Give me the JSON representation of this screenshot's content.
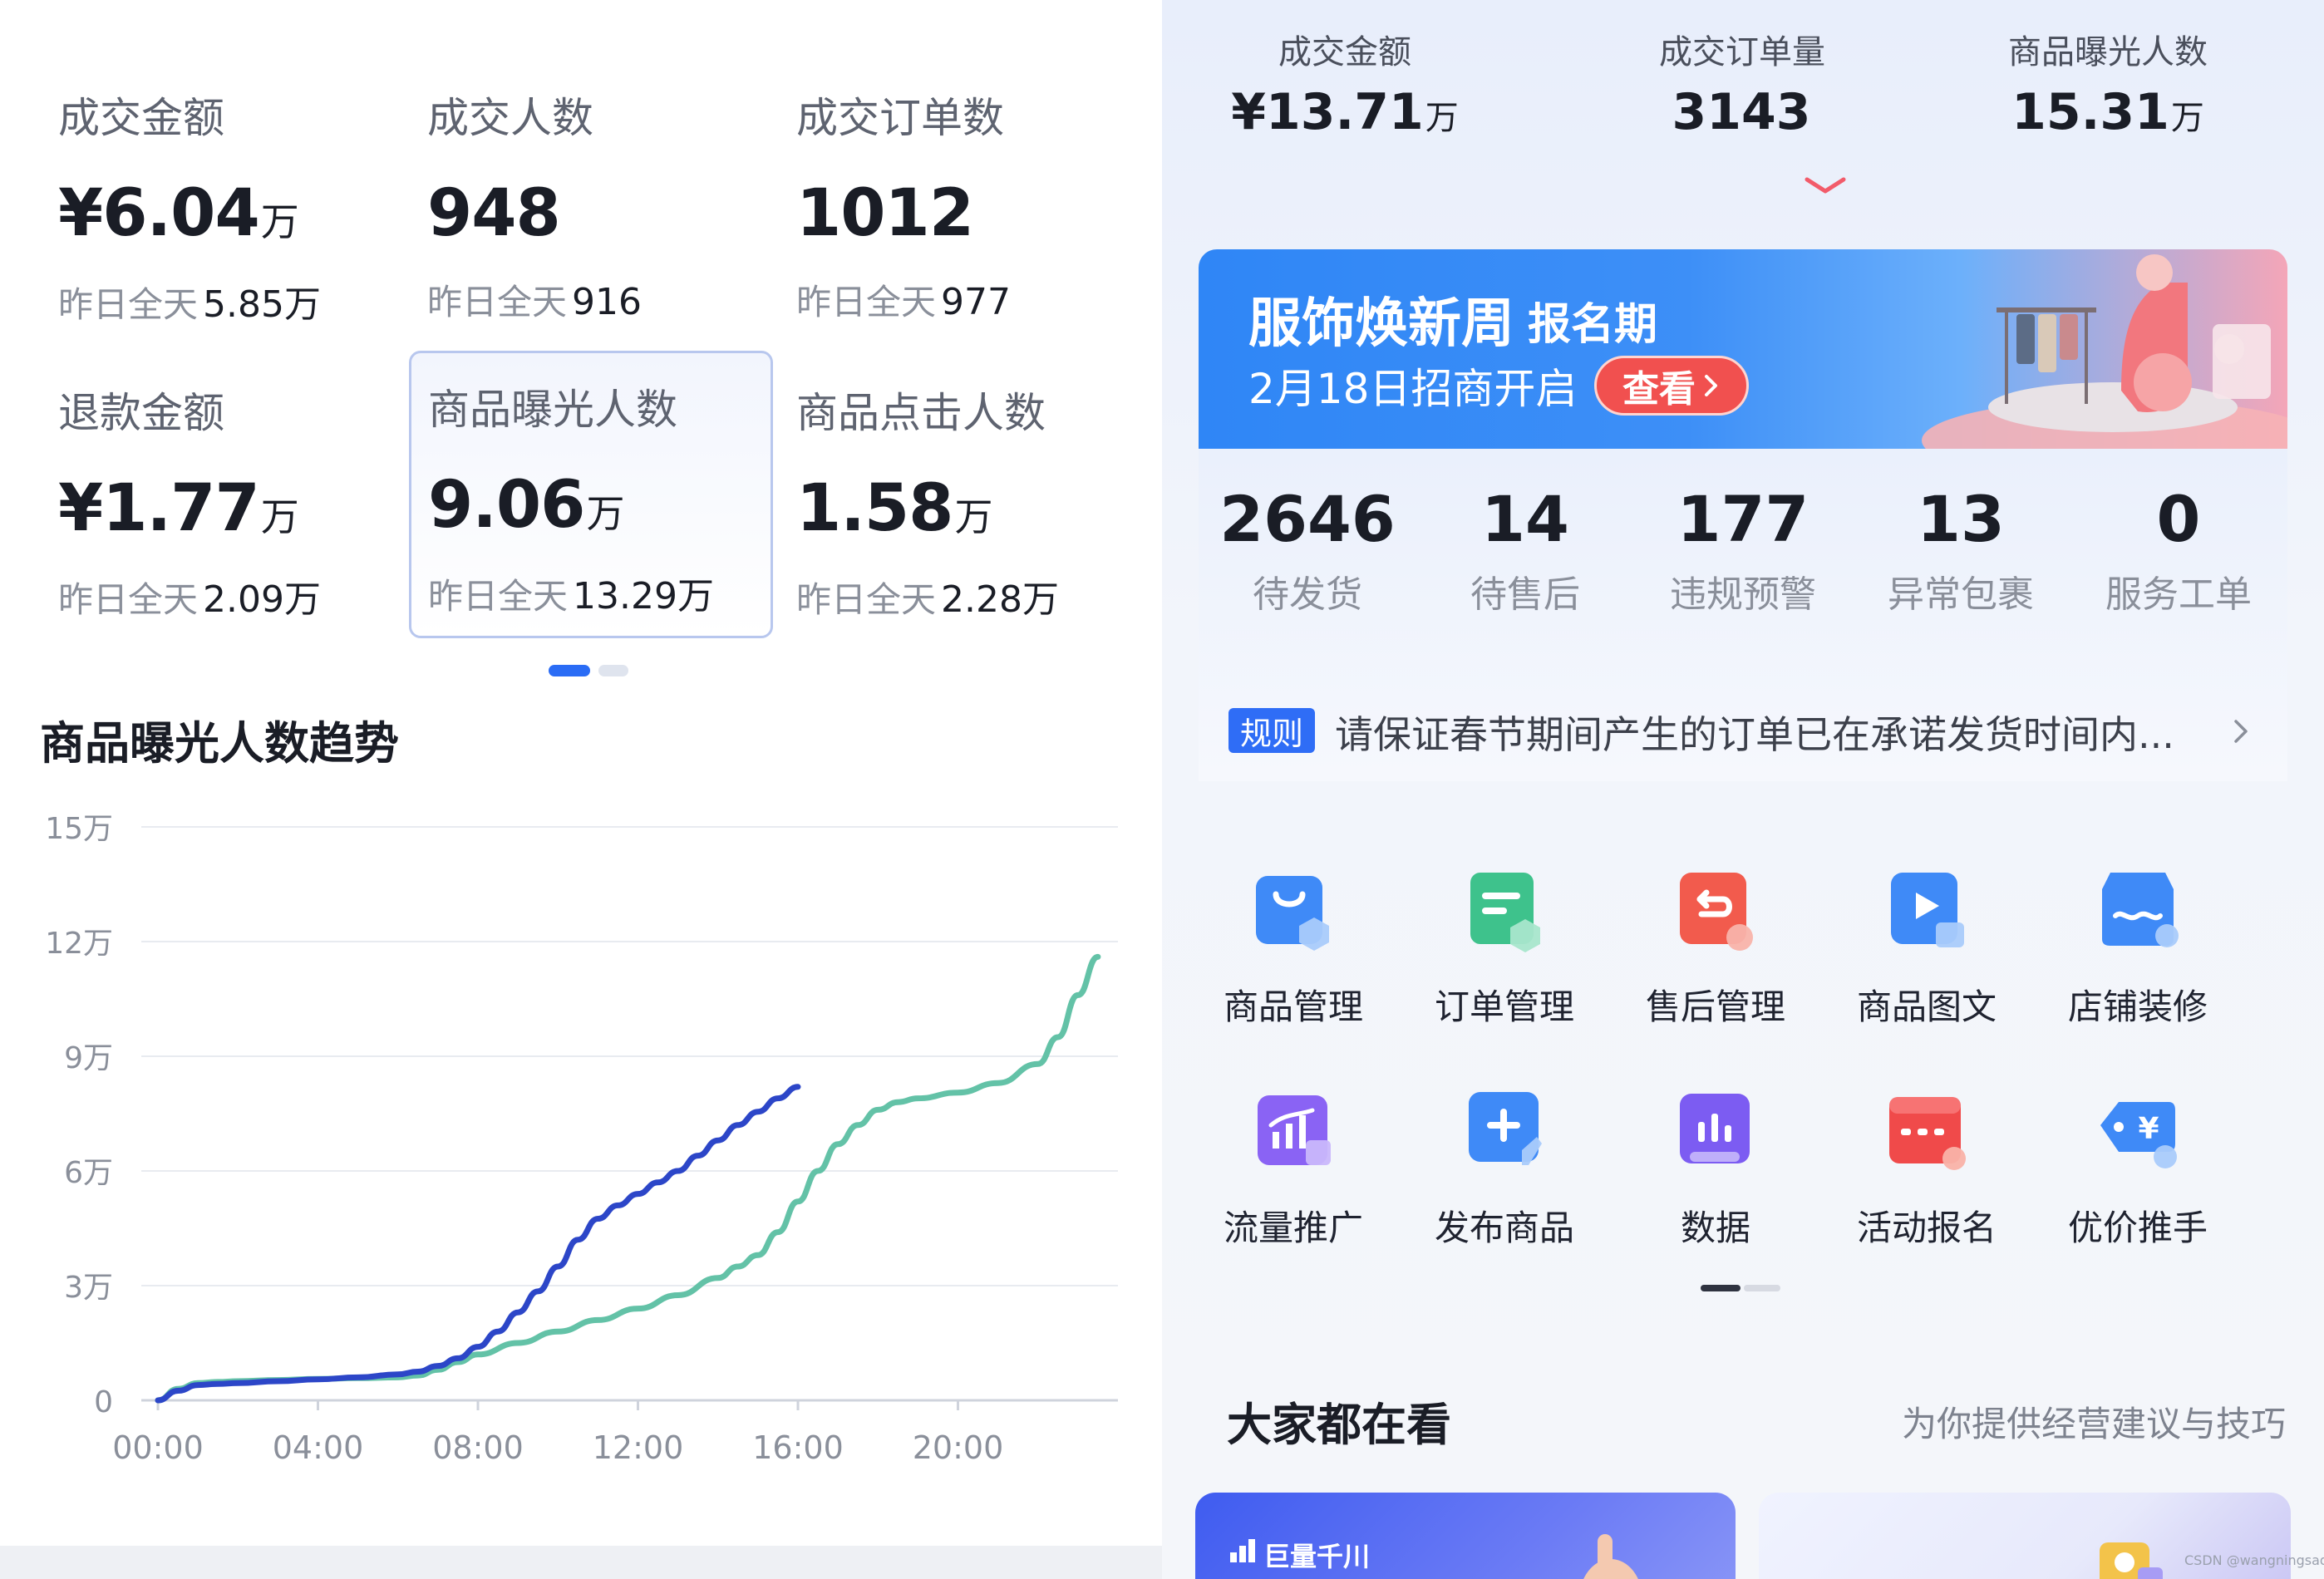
{
  "left": {
    "metrics": [
      {
        "label": "成交金额",
        "value": "¥6.04",
        "unit": "万",
        "yesterday_label": "昨日全天",
        "yesterday_value": "5.85万"
      },
      {
        "label": "成交人数",
        "value": "948",
        "unit": "",
        "yesterday_label": "昨日全天",
        "yesterday_value": "916"
      },
      {
        "label": "成交订单数",
        "value": "1012",
        "unit": "",
        "yesterday_label": "昨日全天",
        "yesterday_value": "977"
      },
      {
        "label": "退款金额",
        "value": "¥1.77",
        "unit": "万",
        "yesterday_label": "昨日全天",
        "yesterday_value": "2.09万"
      },
      {
        "label": "商品曝光人数",
        "value": "9.06",
        "unit": "万",
        "yesterday_label": "昨日全天",
        "yesterday_value": "13.29万"
      },
      {
        "label": "商品点击人数",
        "value": "1.58",
        "unit": "万",
        "yesterday_label": "昨日全天",
        "yesterday_value": "2.28万"
      }
    ],
    "selected_metric_index": 4,
    "trend_title": "商品曝光人数趋势"
  },
  "chart_data": {
    "type": "line",
    "title": "商品曝光人数趋势",
    "xlabel": "",
    "ylabel": "",
    "x_ticks": [
      "00:00",
      "04:00",
      "08:00",
      "12:00",
      "16:00",
      "20:00"
    ],
    "y_ticks": [
      "0",
      "3万",
      "6万",
      "9万",
      "12万",
      "15万"
    ],
    "ylim": [
      0,
      150000
    ],
    "xlim_hours": [
      0,
      24
    ],
    "grid": true,
    "colors": {
      "today": "#2c46c8",
      "yesterday": "#63c2a7"
    },
    "series": [
      {
        "key": "today",
        "x_hours": [
          0,
          0.5,
          1,
          1.5,
          2,
          3,
          4,
          5,
          6,
          6.5,
          7,
          7.5,
          8,
          8.5,
          9,
          9.5,
          10,
          10.5,
          11,
          11.5,
          12,
          12.5,
          13,
          13.5,
          14,
          14.5,
          15,
          15.5,
          16
        ],
        "values": [
          0,
          2500,
          4000,
          4300,
          4500,
          5000,
          5500,
          6000,
          6800,
          7500,
          9000,
          11000,
          14000,
          18000,
          23000,
          28500,
          35000,
          42000,
          47500,
          51000,
          54000,
          57000,
          60000,
          64000,
          68000,
          72000,
          75500,
          79000,
          82000
        ]
      },
      {
        "key": "yesterday",
        "x_hours": [
          0,
          0.5,
          1,
          1.5,
          2,
          3,
          4,
          5,
          6,
          6.5,
          7,
          7.5,
          8,
          9,
          10,
          11,
          12,
          13,
          14,
          14.5,
          15,
          15.5,
          16,
          16.5,
          17,
          17.5,
          18,
          18.5,
          19,
          20,
          21,
          22,
          22.5,
          23,
          23.5
        ],
        "values": [
          0,
          3000,
          4500,
          4800,
          5000,
          5300,
          5600,
          5800,
          6000,
          6500,
          8000,
          10000,
          12000,
          15000,
          18000,
          21000,
          24000,
          27500,
          32000,
          35000,
          38000,
          44000,
          52000,
          60000,
          67000,
          72000,
          76000,
          78000,
          79000,
          80500,
          83000,
          88000,
          95000,
          106000,
          116000
        ]
      }
    ]
  },
  "right": {
    "top_stats": [
      {
        "label": "成交金额",
        "value": "¥13.71",
        "unit": "万"
      },
      {
        "label": "成交订单量",
        "value": "3143",
        "unit": ""
      },
      {
        "label": "商品曝光人数",
        "value": "15.31",
        "unit": "万"
      }
    ],
    "banner": {
      "title": "服饰焕新周",
      "tag": "报名期",
      "subtitle": "2月18日招商开启",
      "button": "查看"
    },
    "counts": [
      {
        "value": "2646",
        "label": "待发货"
      },
      {
        "value": "14",
        "label": "待售后"
      },
      {
        "value": "177",
        "label": "违规预警"
      },
      {
        "value": "13",
        "label": "异常包裹"
      },
      {
        "value": "0",
        "label": "服务工单"
      }
    ],
    "notice": {
      "tag": "规则",
      "text": "请保证春节期间产生的订单已在承诺发货时间内..."
    },
    "tools": [
      {
        "label": "商品管理",
        "icon": "bag-icon",
        "color": "#3f8af7"
      },
      {
        "label": "订单管理",
        "icon": "order-icon",
        "color": "#3ec28c"
      },
      {
        "label": "售后管理",
        "icon": "return-icon",
        "color": "#f25b4d"
      },
      {
        "label": "商品图文",
        "icon": "video-icon",
        "color": "#3f8af7"
      },
      {
        "label": "店铺装修",
        "icon": "store-icon",
        "color": "#3f8af7"
      },
      {
        "label": "流量推广",
        "icon": "traffic-icon",
        "color": "#8a63f4"
      },
      {
        "label": "发布商品",
        "icon": "plus-icon",
        "color": "#3f8af7"
      },
      {
        "label": "数据",
        "icon": "bar-chart-icon",
        "color": "#7c5cf2"
      },
      {
        "label": "活动报名",
        "icon": "calendar-icon",
        "color": "#f04a4a"
      },
      {
        "label": "优价推手",
        "icon": "price-tag-icon",
        "color": "#3f8af7"
      }
    ],
    "recommend": {
      "title": "大家都在看",
      "subtitle": "为你提供经营建议与技巧"
    },
    "cards": [
      {
        "brand": "巨量千川"
      }
    ],
    "credit": "CSDN @wangningsad"
  }
}
